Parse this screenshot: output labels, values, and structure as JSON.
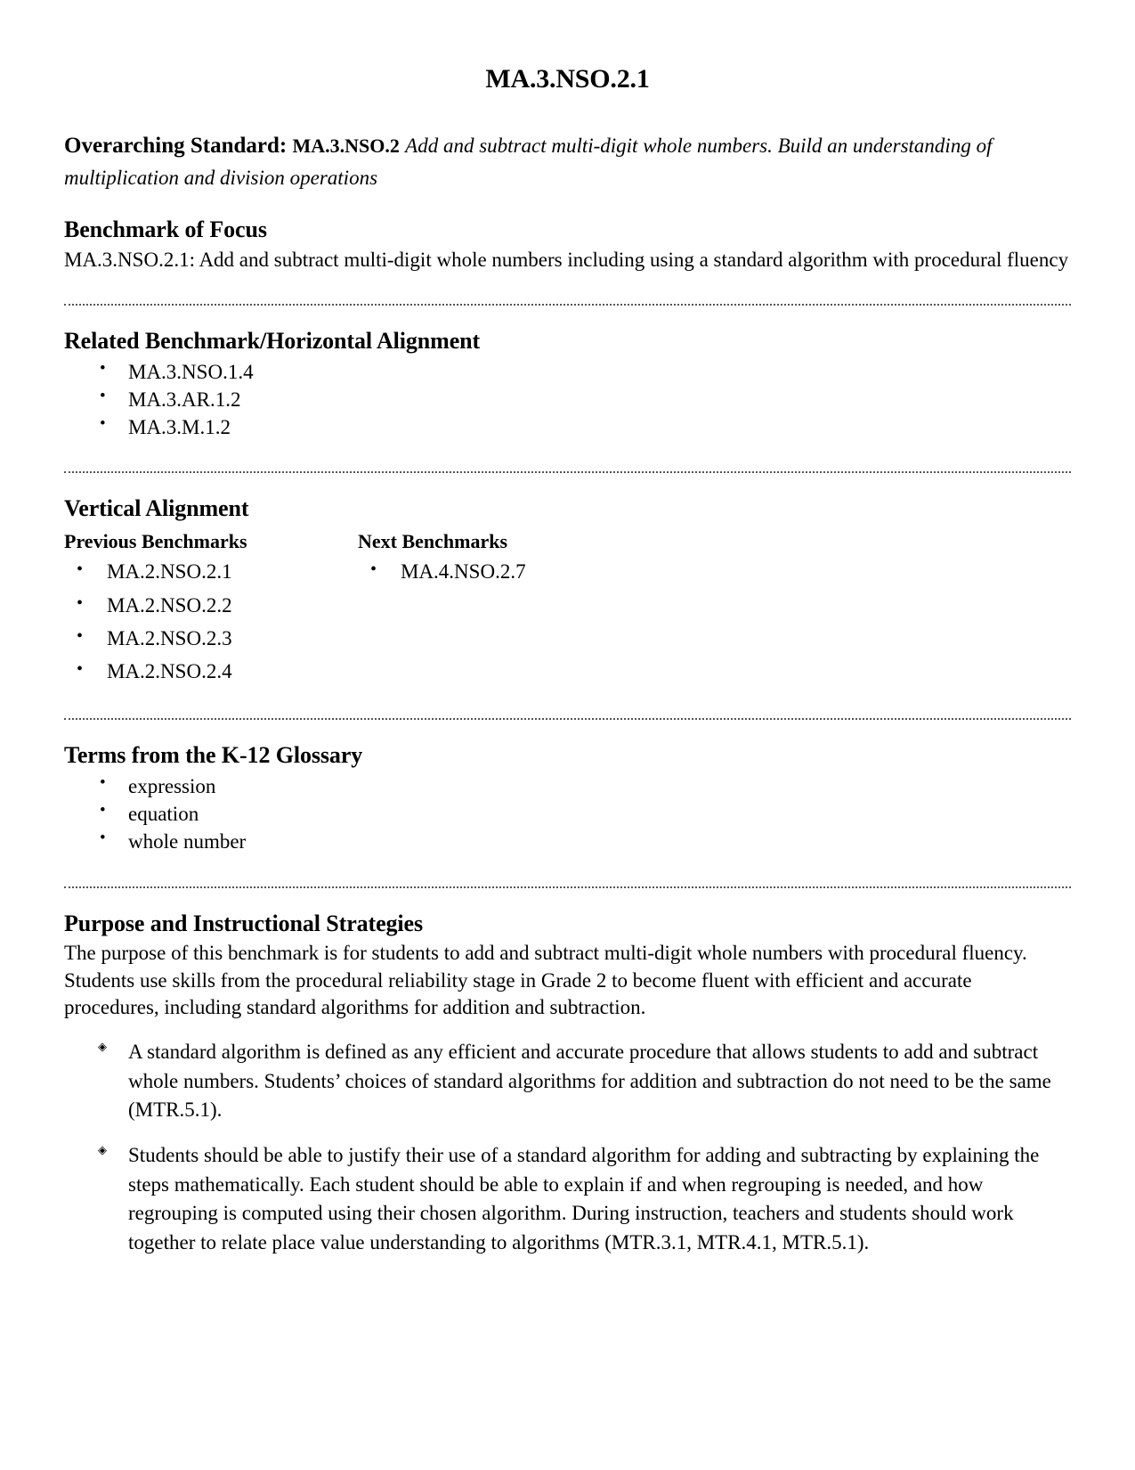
{
  "document": {
    "title": "MA.3.NSO.2.1"
  },
  "overarching": {
    "label": "Overarching Standard:",
    "code": "MA.3.NSO.2",
    "description": "Add and subtract multi-digit whole numbers.  Build an understanding of multiplication and division operations"
  },
  "benchmark_of_focus": {
    "heading": "Benchmark of Focus",
    "text": "MA.3.NSO.2.1: Add and subtract multi-digit whole numbers including using a standard algorithm with procedural fluency"
  },
  "related_benchmark": {
    "heading": "Related Benchmark/Horizontal Alignment",
    "items": [
      "MA.3.NSO.1.4",
      "MA.3.AR.1.2",
      "MA.3.M.1.2"
    ]
  },
  "vertical_alignment": {
    "heading": "Vertical Alignment",
    "previous": {
      "heading": "Previous Benchmarks",
      "items": [
        "MA.2.NSO.2.1",
        "MA.2.NSO.2.2",
        "MA.2.NSO.2.3",
        "MA.2.NSO.2.4"
      ]
    },
    "next": {
      "heading": "Next Benchmarks",
      "items": [
        "MA.4.NSO.2.7"
      ]
    }
  },
  "glossary": {
    "heading": "Terms from the K-12 Glossary",
    "items": [
      "expression",
      "equation",
      "whole number"
    ]
  },
  "purpose": {
    "heading": "Purpose and Instructional Strategies",
    "paragraph": "The purpose of this benchmark is for students to add and subtract multi-digit whole numbers with procedural fluency. Students use skills from the procedural reliability stage in Grade 2 to become fluent with efficient and accurate procedures, including standard algorithms for addition and subtraction.",
    "bullets": [
      "A standard algorithm is defined as any efficient and accurate procedure that allows students to add and subtract whole numbers. Students’ choices of standard algorithms for addition and subtraction do not need to be the same (MTR.5.1).",
      "Students should be able to justify their use of a standard algorithm for adding and subtracting by explaining the steps mathematically. Each student should be able to explain if and when regrouping is needed, and how regrouping is computed using their chosen algorithm. During instruction, teachers and students should work together to relate place value understanding to algorithms (MTR.3.1, MTR.4.1, MTR.5.1)."
    ]
  }
}
